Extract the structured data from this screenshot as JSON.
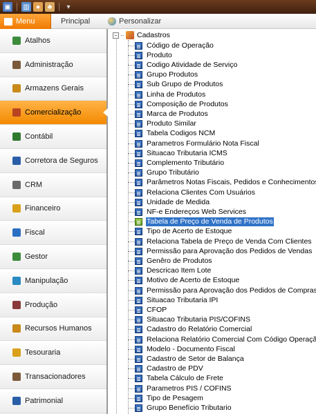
{
  "ribbon": {
    "menu_label": "Menu",
    "tabs": [
      "Principal",
      "Personalizar"
    ]
  },
  "nav": {
    "items": [
      {
        "label": "Atalhos",
        "icon": "shortcut-icon",
        "color": "#3d8c3d"
      },
      {
        "label": "Administração",
        "icon": "admin-icon",
        "color": "#7a5a3a"
      },
      {
        "label": "Armazens Gerais",
        "icon": "warehouse-icon",
        "color": "#c98a1a"
      },
      {
        "label": "Comercialização",
        "icon": "commerce-icon",
        "color": "#b8451f"
      },
      {
        "label": "Contábil",
        "icon": "accounting-icon",
        "color": "#2f7a2f"
      },
      {
        "label": "Corretora de Seguros",
        "icon": "insurance-icon",
        "color": "#2a5fa8"
      },
      {
        "label": "CRM",
        "icon": "crm-icon",
        "color": "#6a6a6a"
      },
      {
        "label": "Financeiro",
        "icon": "finance-icon",
        "color": "#d9a11a"
      },
      {
        "label": "Fiscal",
        "icon": "fiscal-icon",
        "color": "#2a6fc2"
      },
      {
        "label": "Gestor",
        "icon": "manager-icon",
        "color": "#3d8c3d"
      },
      {
        "label": "Manipulação",
        "icon": "manipulation-icon",
        "color": "#2a8ac2"
      },
      {
        "label": "Produção",
        "icon": "production-icon",
        "color": "#8a3a3a"
      },
      {
        "label": "Recursos Humanos",
        "icon": "hr-icon",
        "color": "#c98a1a"
      },
      {
        "label": "Tesouraria",
        "icon": "treasury-icon",
        "color": "#d9a11a"
      },
      {
        "label": "Transacionadores",
        "icon": "traders-icon",
        "color": "#7a5a3a"
      },
      {
        "label": "Patrimonial",
        "icon": "patrimony-icon",
        "color": "#2a5fa8"
      }
    ],
    "active_index": 3
  },
  "tree": {
    "root_label": "Cadastros",
    "selected_index": 18,
    "items": [
      "Código de Operação",
      "Produto",
      "Codigo Atividade de Serviço",
      "Grupo Produtos",
      "Sub Grupo de Produtos",
      "Linha de Produtos",
      "Composição de Produtos",
      "Marca de Produtos",
      "Produto Similar",
      "Tabela Codigos NCM",
      "Parametros Formulário Nota Fiscal",
      "Situacao Tributaria ICMS",
      "Complemento Tributário",
      "Grupo Tributário",
      "Parâmetros Notas Fiscais, Pedidos e Conhecimentos",
      "Relaciona Clientes Com Usuários",
      "Unidade de Medida",
      "NF-e Endereços Web Services",
      "Tabela de Preço de Venda de Produtos",
      "Tipo de Acerto de Estoque",
      "Relaciona Tabela de Preço de Venda Com Clientes",
      "Permissão para Aprovação dos Pedidos de Vendas",
      "Genêro de Produtos",
      "Descricao Item Lote",
      "Motivo de Acerto de Estoque",
      "Permissão para Aprovação dos Pedidos de Compras",
      "Situacao Tributaria IPI",
      "CFOP",
      "Situacao Tributaria PIS/COFINS",
      "Cadastro do Relatório Comercial",
      "Relaciona Relatório Comercial Com Código Operação",
      "Modelo - Documento Fiscal",
      "Cadastro de Setor de Balança",
      "Cadastro de PDV",
      "Tabela Cálculo de Frete",
      "Parametros PIS / COFINS",
      "Tipo de Pesagem",
      "Grupo Benefício Tributario"
    ]
  }
}
